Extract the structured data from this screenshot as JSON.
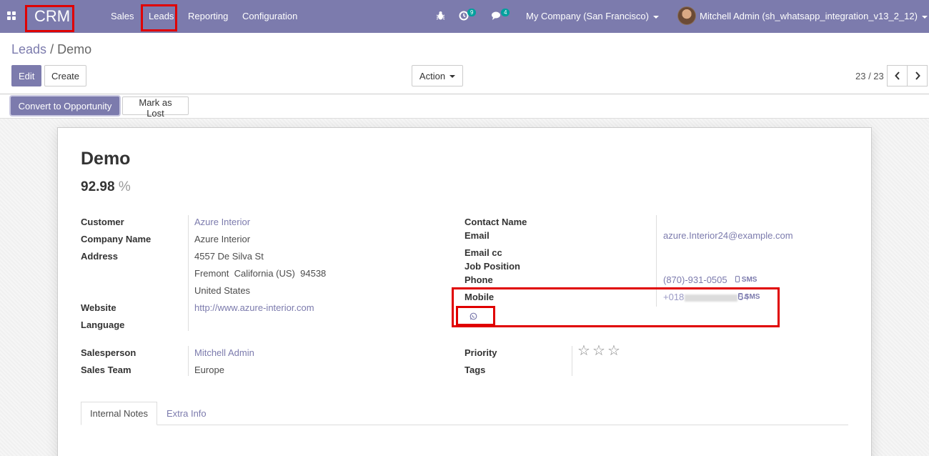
{
  "navbar": {
    "brand": "CRM",
    "menu": [
      "Sales",
      "Leads",
      "Reporting",
      "Configuration"
    ],
    "activity_count": "9",
    "message_count": "4",
    "company": "My Company (San Francisco)",
    "user": "Mitchell Admin (sh_whatsapp_integration_v13_2_12)"
  },
  "breadcrumb": {
    "parent": "Leads",
    "separator": "/",
    "current": "Demo"
  },
  "buttons": {
    "edit": "Edit",
    "create": "Create",
    "action": "Action"
  },
  "pager": {
    "text": "23 / 23"
  },
  "statusbar": {
    "convert": "Convert to Opportunity",
    "mark_lost": "Mark as Lost"
  },
  "lead": {
    "name": "Demo",
    "probability": "92.98",
    "probability_unit": "%",
    "labels": {
      "customer": "Customer",
      "company_name": "Company Name",
      "address": "Address",
      "website": "Website",
      "language": "Language",
      "salesperson": "Salesperson",
      "sales_team": "Sales Team",
      "contact_name": "Contact Name",
      "email": "Email",
      "email_cc": "Email cc",
      "job_position": "Job Position",
      "phone": "Phone",
      "mobile": "Mobile",
      "priority": "Priority",
      "tags": "Tags"
    },
    "customer": "Azure Interior",
    "company_name": "Azure Interior",
    "address_street": "4557 De Silva St",
    "address_city": "Fremont",
    "address_state": "California (US)",
    "address_zip": "94538",
    "address_country": "United States",
    "website": "http://www.azure-interior.com",
    "salesperson": "Mitchell Admin",
    "sales_team": "Europe",
    "email": "azure.Interior24@example.com",
    "phone": "(870)-931-0505",
    "mobile_prefix": "+018",
    "mobile_suffix": "54",
    "sms_label": "SMS",
    "priority_stars": 0,
    "priority_max": 3
  },
  "tabs": {
    "internal_notes": "Internal Notes",
    "extra_info": "Extra Info"
  },
  "colors": {
    "brand": "#7c7bad",
    "highlight": "#e00000",
    "badge": "#00a09d"
  }
}
